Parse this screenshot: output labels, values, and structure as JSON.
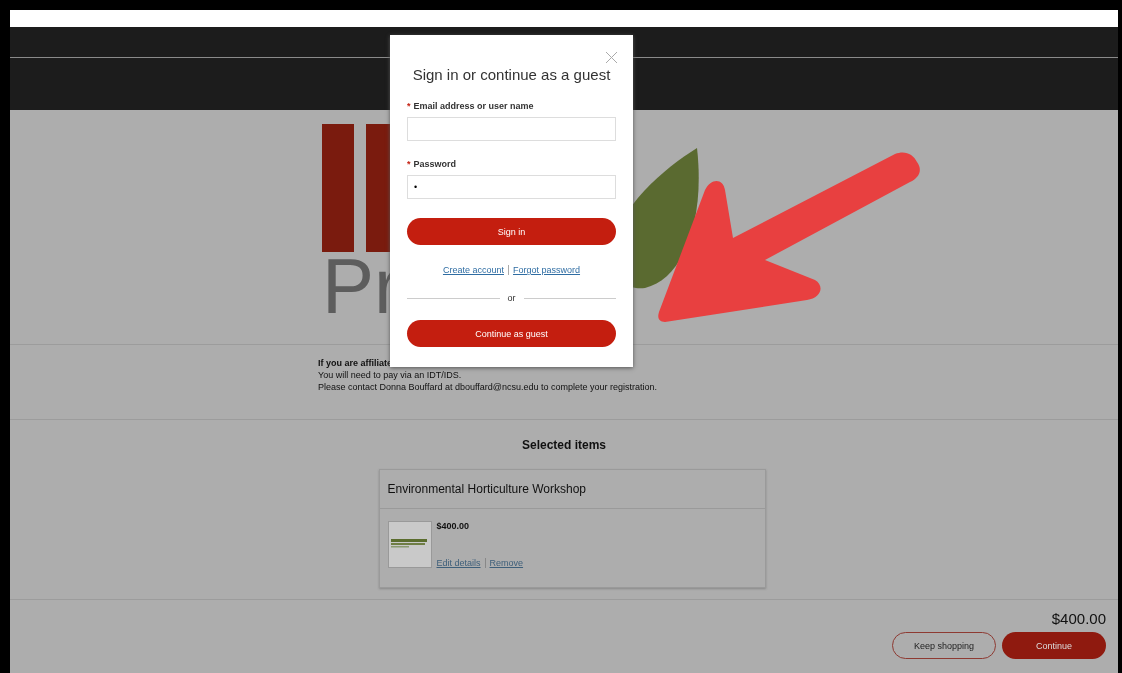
{
  "logo": {
    "text": "Pr"
  },
  "notice": {
    "lines": [
      {
        "text": "If you are affiliate",
        "bold": true
      },
      {
        "text": "You will need to pay via an IDT/IDS.",
        "bold": false
      },
      {
        "text": "Please contact Donna Bouffard at dbouffard@ncsu.edu to complete your registration.",
        "bold": false
      }
    ]
  },
  "selected_items": {
    "title": "Selected items",
    "items": [
      {
        "name": "Environmental Horticulture Workshop",
        "price": "$400.00",
        "image": {
          "kind": "picture"
        },
        "links": [
          "Edit details",
          "Remove"
        ]
      }
    ]
  },
  "total": "$400.00",
  "buttons": [
    {
      "label": "Keep shopping",
      "kind": "secondary"
    },
    {
      "label": "Continue",
      "kind": "primary"
    }
  ],
  "dialog": {
    "title": "Sign in or continue as a guest",
    "fields": [
      {
        "label": "Email address or user name",
        "required_mark": "*"
      },
      {
        "label": "Password",
        "required_mark": "*",
        "value": "•"
      }
    ],
    "submit": "Sign in",
    "links": [
      "Create account",
      "Forgot password"
    ],
    "separator": "or",
    "guest_button": "Continue as guest"
  }
}
